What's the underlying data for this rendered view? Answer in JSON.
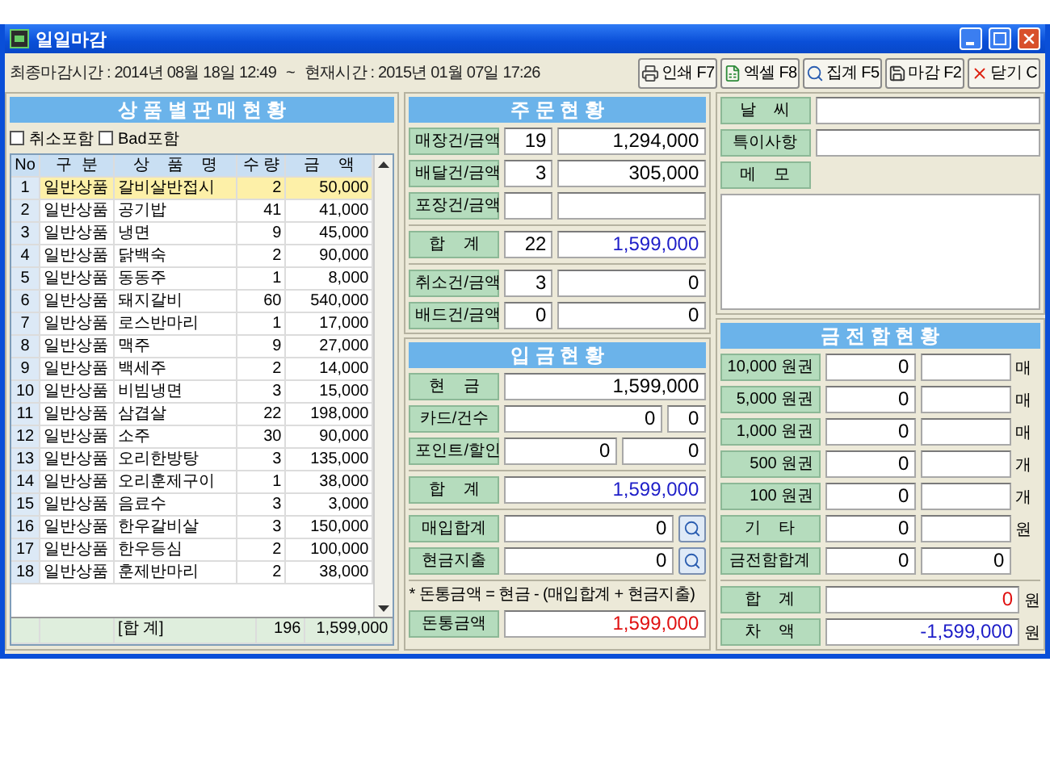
{
  "window": {
    "title": "일일마감"
  },
  "toolbar": {
    "last_close": "최종마감시간 : 2014년 08월 18일 12:49",
    "separator": "~",
    "now": "현재시간 : 2015년 01월 07일 17:26",
    "buttons": [
      {
        "label": "인쇄 F7"
      },
      {
        "label": "엑셀 F8"
      },
      {
        "label": "집계 F5"
      },
      {
        "label": "마감 F2"
      },
      {
        "label": "닫기 C"
      }
    ]
  },
  "sales": {
    "title": "상 품 별 판 매 현 황",
    "filters": [
      {
        "label": "취소포함",
        "checked": false
      },
      {
        "label": "Bad포함",
        "checked": false
      }
    ],
    "columns": [
      "No",
      "구  분",
      "상    품    명",
      "수 량",
      "금    액"
    ],
    "rows": [
      {
        "no": "1",
        "category": "일반상품",
        "name": "갈비살반접시",
        "qty": "2",
        "amount": "50,000",
        "selected": true
      },
      {
        "no": "2",
        "category": "일반상품",
        "name": "공기밥",
        "qty": "41",
        "amount": "41,000",
        "selected": false
      },
      {
        "no": "3",
        "category": "일반상품",
        "name": "냉면",
        "qty": "9",
        "amount": "45,000",
        "selected": false
      },
      {
        "no": "4",
        "category": "일반상품",
        "name": "닭백숙",
        "qty": "2",
        "amount": "90,000",
        "selected": false
      },
      {
        "no": "5",
        "category": "일반상품",
        "name": "동동주",
        "qty": "1",
        "amount": "8,000",
        "selected": false
      },
      {
        "no": "6",
        "category": "일반상품",
        "name": "돼지갈비",
        "qty": "60",
        "amount": "540,000",
        "selected": false
      },
      {
        "no": "7",
        "category": "일반상품",
        "name": "로스반마리",
        "qty": "1",
        "amount": "17,000",
        "selected": false
      },
      {
        "no": "8",
        "category": "일반상품",
        "name": "맥주",
        "qty": "9",
        "amount": "27,000",
        "selected": false
      },
      {
        "no": "9",
        "category": "일반상품",
        "name": "백세주",
        "qty": "2",
        "amount": "14,000",
        "selected": false
      },
      {
        "no": "10",
        "category": "일반상품",
        "name": "비빔냉면",
        "qty": "3",
        "amount": "15,000",
        "selected": false
      },
      {
        "no": "11",
        "category": "일반상품",
        "name": "삼겹살",
        "qty": "22",
        "amount": "198,000",
        "selected": false
      },
      {
        "no": "12",
        "category": "일반상품",
        "name": "소주",
        "qty": "30",
        "amount": "90,000",
        "selected": false
      },
      {
        "no": "13",
        "category": "일반상품",
        "name": "오리한방탕",
        "qty": "3",
        "amount": "135,000",
        "selected": false
      },
      {
        "no": "14",
        "category": "일반상품",
        "name": "오리훈제구이",
        "qty": "1",
        "amount": "38,000",
        "selected": false
      },
      {
        "no": "15",
        "category": "일반상품",
        "name": "음료수",
        "qty": "3",
        "amount": "3,000",
        "selected": false
      },
      {
        "no": "16",
        "category": "일반상품",
        "name": "한우갈비살",
        "qty": "3",
        "amount": "150,000",
        "selected": false
      },
      {
        "no": "17",
        "category": "일반상품",
        "name": "한우등심",
        "qty": "2",
        "amount": "100,000",
        "selected": false
      },
      {
        "no": "18",
        "category": "일반상품",
        "name": "훈제반마리",
        "qty": "2",
        "amount": "38,000",
        "selected": false
      }
    ],
    "total": {
      "label": "[합 계]",
      "qty": "196",
      "amount": "1,599,000"
    }
  },
  "orders": {
    "title": "주 문 현 황",
    "groups": [
      [
        {
          "label": "매장건/금액",
          "count": "19",
          "amount": "1,294,000",
          "kind": "item"
        },
        {
          "label": "배달건/금액",
          "count": "3",
          "amount": "305,000",
          "kind": "item"
        },
        {
          "label": "포장건/금액",
          "kind": "item"
        }
      ],
      [
        {
          "label": "합    계",
          "count": "22",
          "amount": "1,599,000",
          "kind": "total"
        }
      ],
      [
        {
          "label": "취소건/금액",
          "count": "3",
          "amount": "0",
          "kind": "item"
        },
        {
          "label": "배드건/금액",
          "count": "0",
          "amount": "0",
          "kind": "item"
        }
      ]
    ]
  },
  "deposits": {
    "title": "입 금 현 황",
    "rows": [
      {
        "label": "현    금",
        "values": [
          "1,599,000"
        ]
      },
      {
        "label": "카드/건수",
        "values": [
          "0",
          "0"
        ]
      },
      {
        "label": "포인트/할인",
        "values": [
          "0",
          "0"
        ]
      }
    ],
    "total": {
      "label": "합    계",
      "value": "1,599,000"
    },
    "lookups": [
      {
        "label": "매입합계",
        "value": "0"
      },
      {
        "label": "현금지출",
        "value": "0"
      }
    ],
    "note": "* 돈통금액 = 현금 - (매입합계 + 현금지출)",
    "cashbox": {
      "label": "돈통금액",
      "value": "1,599,000"
    }
  },
  "info": {
    "fields": [
      {
        "label": "날    씨"
      },
      {
        "label": "특이사항"
      }
    ],
    "memo": {
      "label": "메    모"
    }
  },
  "drawer": {
    "title": "금 전 함 현 황",
    "rows": [
      {
        "label": "10,000 원권",
        "amount": "0",
        "unit": "매"
      },
      {
        "label": "5,000 원권",
        "amount": "0",
        "unit": "매"
      },
      {
        "label": "1,000 원권",
        "amount": "0",
        "unit": "매"
      },
      {
        "label": "500 원권",
        "amount": "0",
        "unit": "개"
      },
      {
        "label": "100 원권",
        "amount": "0",
        "unit": "개"
      },
      {
        "label": "기    타",
        "amount": "0",
        "unit": "원"
      }
    ],
    "total": {
      "label": "금전함합계",
      "amount": "0",
      "count": "0"
    },
    "summary": [
      {
        "label": "합    계",
        "value": "0",
        "unit": "원",
        "kind": "sum"
      },
      {
        "label": "차    액",
        "value": "-1,599,000",
        "unit": "원",
        "kind": "difference"
      }
    ]
  }
}
